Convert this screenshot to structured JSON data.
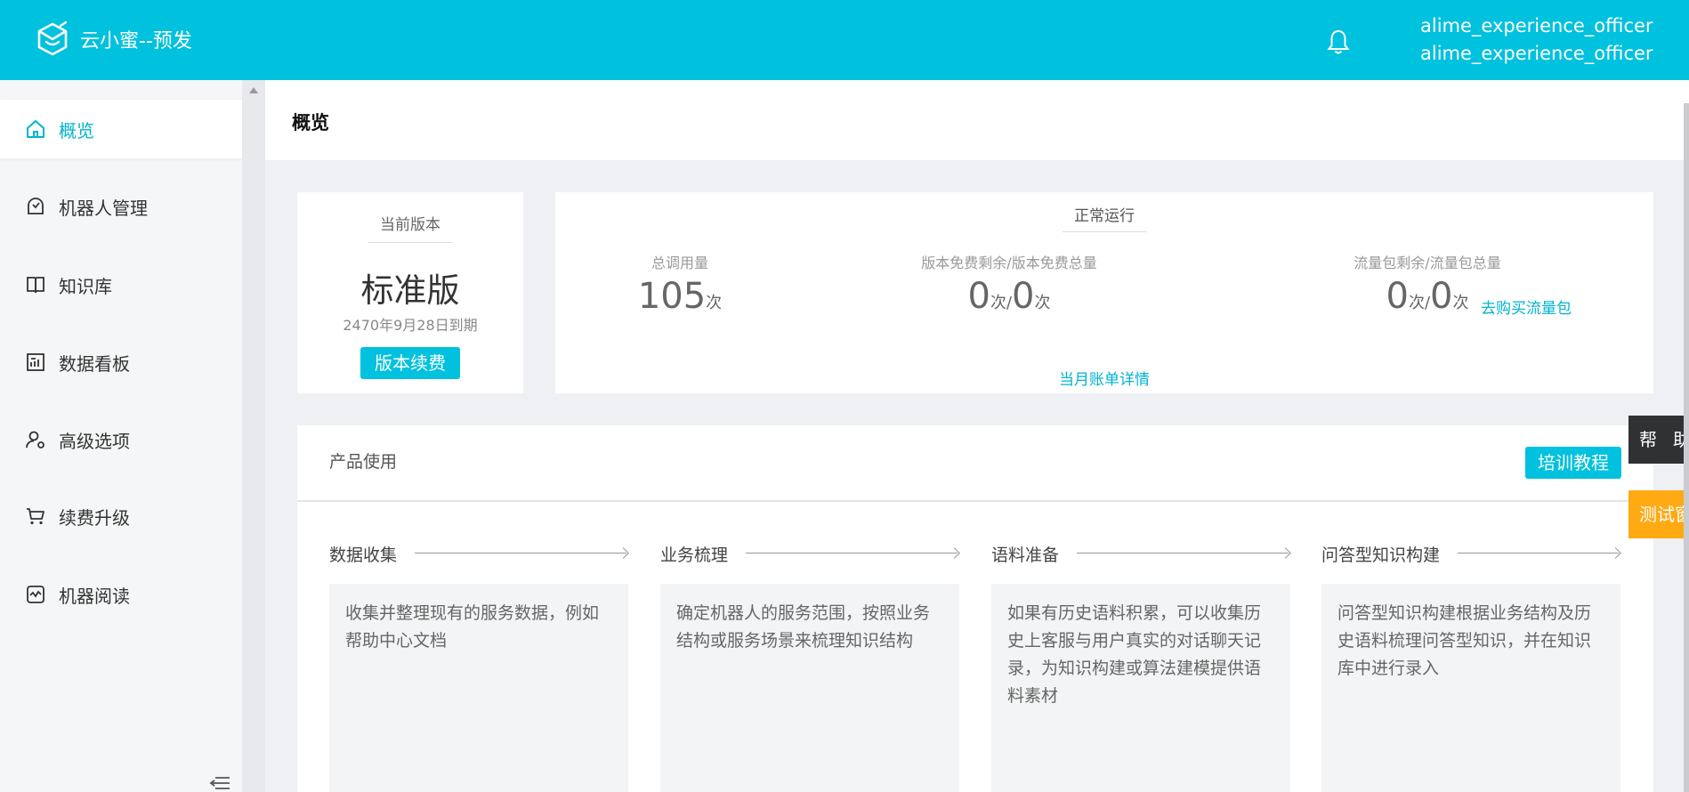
{
  "header": {
    "app_title": "云小蜜--预发",
    "user_line1": "alime_experience_officer",
    "user_line2": "alime_experience_officer",
    "bell_icon": "bell-icon",
    "accent_color": "#00c1de"
  },
  "sidebar": {
    "items": [
      {
        "label": "概览",
        "icon": "home-icon",
        "active": true
      },
      {
        "label": "机器人管理",
        "icon": "robot-icon"
      },
      {
        "label": "知识库",
        "icon": "book-icon"
      },
      {
        "label": "数据看板",
        "icon": "dashboard-icon"
      },
      {
        "label": "高级选项",
        "icon": "user-settings-icon"
      },
      {
        "label": "续费升级",
        "icon": "cart-icon"
      },
      {
        "label": "机器阅读",
        "icon": "reading-icon"
      }
    ]
  },
  "page": {
    "title": "概览"
  },
  "version": {
    "label": "当前版本",
    "name": "标准版",
    "expire": "2470年9月28日到期",
    "renew_button": "版本续费"
  },
  "usage": {
    "status": "正常运行",
    "total_label": "总调用量",
    "total_value": "105",
    "unit": "次",
    "separator": "/",
    "free_label": "版本免费剩余/版本免费总量",
    "free_remaining": "0",
    "free_total": "0",
    "traffic_label": "流量包剩余/流量包总量",
    "traffic_remaining": "0",
    "traffic_total": "0",
    "buy_link": "去购买流量包",
    "bill_link": "当月账单详情"
  },
  "product": {
    "title": "产品使用",
    "tutorial_button": "培训教程",
    "steps": [
      {
        "name": "数据收集",
        "desc": "收集并整理现有的服务数据，例如帮助中心文档"
      },
      {
        "name": "业务梳理",
        "desc": "确定机器人的服务范围，按照业务结构或服务场景来梳理知识结构"
      },
      {
        "name": "语料准备",
        "desc": "如果有历史语料积累，可以收集历史上客服与用户真实的对话聊天记录，为知识构建或算法建模提供语料素材"
      },
      {
        "name": "问答型知识构建",
        "desc": "问答型知识构建根据业务结构及历史语料梳理问答型知识，并在知识库中进行录入"
      }
    ]
  },
  "floating": {
    "help": "帮助",
    "test": "测试窗"
  }
}
